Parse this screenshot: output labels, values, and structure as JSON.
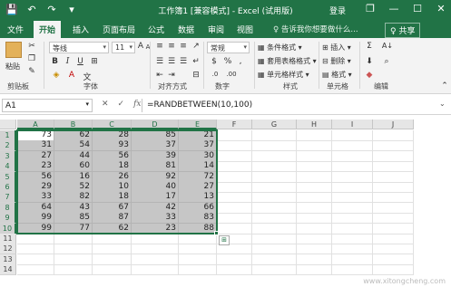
{
  "titlebar": {
    "title": "工作簿1 [兼容模式] - Excel (试用版)",
    "login": "登录",
    "qat": {
      "save": "💾",
      "undo": "↶",
      "redo": "↷",
      "more": "▾"
    },
    "win": {
      "restore": "❐",
      "minimize": "—",
      "maximize": "☐",
      "close": "✕"
    }
  },
  "tabs": [
    "文件",
    "开始",
    "插入",
    "页面布局",
    "公式",
    "数据",
    "审阅",
    "视图"
  ],
  "tellme": "♀ 告诉我你想要做什么...",
  "share": "♀ 共享",
  "ribbon": {
    "clipboard": {
      "paste": "粘贴",
      "label": "剪贴板"
    },
    "font": {
      "name": "等线",
      "size": "11",
      "label": "字体"
    },
    "alignment": {
      "label": "对齐方式"
    },
    "number": {
      "format": "常规",
      "percent": "%",
      "comma": ",",
      "label": "数字"
    },
    "styles": {
      "conditional": "条件格式",
      "table": "套用表格格式",
      "cell": "单元格样式",
      "label": "样式"
    },
    "cells": {
      "insert": "插入",
      "delete": "删除",
      "format": "格式",
      "label": "单元格"
    },
    "editing": {
      "sum": "Σ",
      "sort": "A↓",
      "find": "⌕",
      "label": "编辑"
    }
  },
  "formula_bar": {
    "name_box": "A1",
    "cancel": "✕",
    "enter": "✓",
    "fx": "fx",
    "formula": "=RANDBETWEEN(10,100)"
  },
  "grid": {
    "columns": [
      "A",
      "B",
      "C",
      "D",
      "E",
      "F",
      "G",
      "H",
      "I",
      "J"
    ],
    "row_numbers": [
      "1",
      "2",
      "3",
      "4",
      "5",
      "6",
      "7",
      "8",
      "9",
      "10",
      "11",
      "12",
      "13",
      "14"
    ],
    "data": [
      [
        "73",
        "62",
        "28",
        "85",
        "21"
      ],
      [
        "31",
        "54",
        "93",
        "37",
        "37"
      ],
      [
        "27",
        "44",
        "56",
        "39",
        "30"
      ],
      [
        "23",
        "60",
        "18",
        "81",
        "14"
      ],
      [
        "56",
        "16",
        "26",
        "92",
        "72"
      ],
      [
        "29",
        "52",
        "10",
        "40",
        "27"
      ],
      [
        "33",
        "82",
        "18",
        "17",
        "13"
      ],
      [
        "64",
        "43",
        "67",
        "42",
        "66"
      ],
      [
        "99",
        "85",
        "87",
        "33",
        "83"
      ],
      [
        "99",
        "77",
        "62",
        "23",
        "88"
      ]
    ],
    "quick_analysis": "⊞"
  },
  "watermark": "www.xitongcheng.com",
  "colors": {
    "accent": "#217346",
    "selection": "#c6c6c6"
  }
}
